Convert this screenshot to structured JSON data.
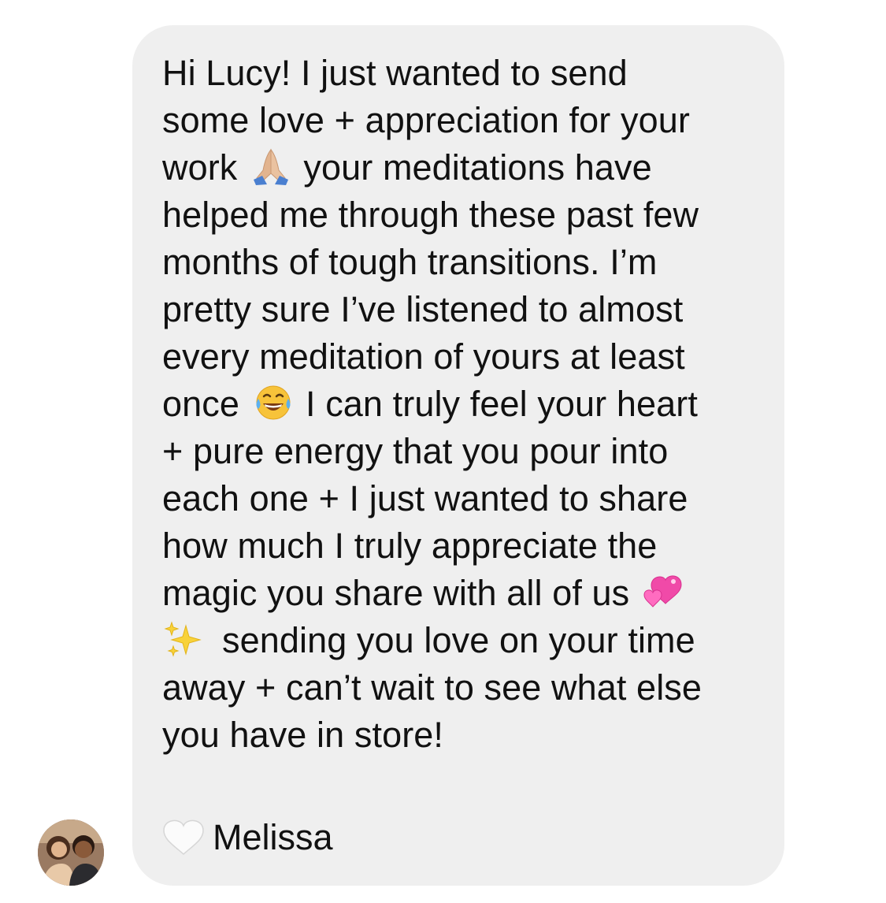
{
  "message": {
    "lines": [
      {
        "before": "Hi Lucy! I just wanted to send",
        "emoji": null,
        "after": ""
      },
      {
        "before": "some love + appreciation for your",
        "emoji": null,
        "after": ""
      },
      {
        "before": "work",
        "emoji": "folded-hands-emoji",
        "after": "your meditations have"
      },
      {
        "before": "helped me through these past few",
        "emoji": null,
        "after": ""
      },
      {
        "before": "months of tough transitions. I’m",
        "emoji": null,
        "after": ""
      },
      {
        "before": "pretty sure I’ve listened to almost",
        "emoji": null,
        "after": ""
      },
      {
        "before": "every meditation of yours at least",
        "emoji": null,
        "after": ""
      },
      {
        "before": "once",
        "emoji": "tears-of-joy-emoji",
        "after": "I can truly feel your heart"
      },
      {
        "before": "+ pure energy that you pour into",
        "emoji": null,
        "after": ""
      },
      {
        "before": "each one + I just wanted to share",
        "emoji": null,
        "after": ""
      },
      {
        "before": "how much I truly appreciate the",
        "emoji": null,
        "after": ""
      },
      {
        "before": "magic you share with all of us",
        "emoji": "two-hearts-emoji",
        "after": ""
      },
      {
        "before": "",
        "emoji": "sparkles-emoji",
        "after": "sending you love on your time"
      },
      {
        "before": "away + can’t wait to see what else",
        "emoji": null,
        "after": ""
      },
      {
        "before": "you have in store!",
        "emoji": null,
        "after": ""
      }
    ],
    "signature": "Melissa",
    "signature_emoji": "white-heart-emoji"
  },
  "sender": {
    "avatar": "profile-photo"
  },
  "colors": {
    "bubble": "#efefef",
    "text": "#111111"
  }
}
